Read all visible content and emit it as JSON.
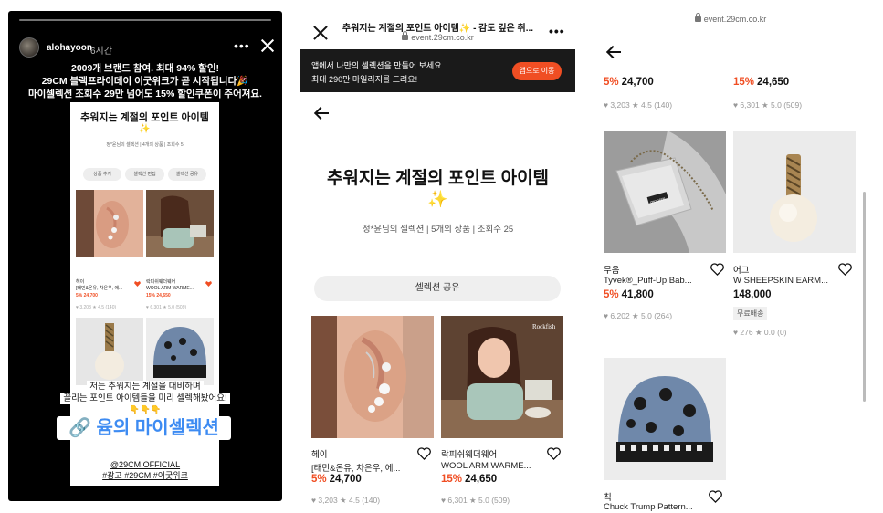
{
  "story": {
    "username": "alohayoon",
    "time": "6시간",
    "banner_lines": [
      "2009개 브랜드 참여. 최대 94% 할인!",
      "29CM 블랙프라이데이 이굿위크가 곧 시작됩니다🎉",
      "마이셀렉션 조회수 29만 넘어도 15% 할인쿠폰이 주어져요."
    ],
    "mock_title": "추워지는 계절의 포인트 아이템",
    "mock_spark": "✨",
    "mock_meta": "정*윤님의 셀렉션 | 4개의 상품 | 조회수 5",
    "mock_buttons": [
      "상품 추가",
      "셀렉션 편집",
      "셀렉션 공유"
    ],
    "mock_products": [
      {
        "brand": "헤이",
        "name": "[태민&온유, 차은우, 에...",
        "price": "5% 24,700",
        "stat": "♥ 3,203 ★ 4.5 (140)"
      },
      {
        "brand": "락피쉬웨더웨어",
        "name": "WOOL ARM WARME...",
        "price": "15% 24,650",
        "stat": "♥ 6,301 ★ 5.0 (509)"
      }
    ],
    "overlay_lines": [
      "저는 추워지는 계절을 대비하며",
      "끌리는 포인트 아이템들을 미리 셀렉해봤어요!",
      "👇👇👇"
    ],
    "link_text": "🔗 윰의 마이셀렉션",
    "hashtags": [
      "@29CM.OFFICIAL",
      "#광고 #29CM #이굿위크"
    ]
  },
  "middle": {
    "page_title": "추워지는 계절의 포인트 아이템✨ - 감도 깊은 취...",
    "url": "event.29cm.co.kr",
    "app_banner_line1": "앱에서 나만의 셀렉션을 만들어 보세요.",
    "app_banner_line2": "최대 290만 마일리지를 드려요!",
    "app_button": "앱으로 이동",
    "heading": "추워지는 계절의 포인트 아이템",
    "sparkle": "✨",
    "meta": "정*윤님의 셀렉션  |  5개의 상품  |  조회수 25",
    "share_button": "셀렉션 공유",
    "products": [
      {
        "brand": "헤이",
        "name": "[태민&온유, 차은우, 에...",
        "discount": "5%",
        "price": "24,700",
        "stat": "♥ 3,203  ★ 4.5 (140)"
      },
      {
        "brand": "락피쉬웨더웨어",
        "name": "WOOL ARM WARME...",
        "discount": "15%",
        "price": "24,650",
        "stat": "♥ 6,301  ★ 5.0 (509)"
      }
    ]
  },
  "right": {
    "url": "event.29cm.co.kr",
    "top_row": [
      {
        "discount": "5%",
        "price": "24,700",
        "stat": "♥ 3,203  ★ 4.5 (140)"
      },
      {
        "discount": "15%",
        "price": "24,650",
        "stat": "♥ 6,301  ★ 5.0 (509)"
      }
    ],
    "products": [
      {
        "brand": "무음",
        "name": "Tyvek®_Puff-Up Bab...",
        "discount": "5%",
        "price": "41,800",
        "stat": "♥ 6,202  ★ 5.0 (264)"
      },
      {
        "brand": "어그",
        "name": "W SHEEPSKIN EARM...",
        "discount": "",
        "price": "148,000",
        "badge": "무료배송",
        "stat": "♥ 276  ★ 0.0 (0)"
      },
      {
        "brand": "칙",
        "name": "Chuck Trump Pattern..."
      }
    ],
    "pouch_label": "mouom"
  },
  "colors": {
    "accent": "#f04e23",
    "link": "#3d8bf2",
    "dark_banner": "#1a1a1a"
  }
}
